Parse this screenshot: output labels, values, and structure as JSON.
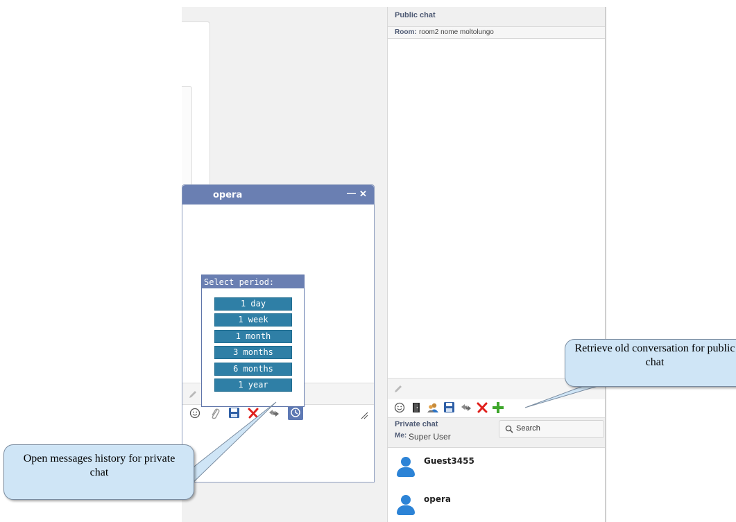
{
  "public_chat": {
    "title": "Public chat",
    "room_label": "Room:",
    "room_name": "room2 nome moltolungo",
    "toolbar_icons": [
      "smiley-icon",
      "door-icon",
      "users-icon",
      "save-icon",
      "refresh-icon",
      "delete-icon",
      "add-icon"
    ]
  },
  "private_chat": {
    "title": "Private chat",
    "me_label": "Me:",
    "me_name": "Super User",
    "search_placeholder": "Search",
    "users": [
      {
        "name": "Guest3455"
      },
      {
        "name": "opera"
      }
    ]
  },
  "chat_window": {
    "title": "opera",
    "minimize_glyph": "—",
    "close_glyph": "✕",
    "toolbar_icons": [
      "smiley-icon",
      "attach-icon",
      "save-icon",
      "delete-icon",
      "refresh-icon",
      "history-icon"
    ]
  },
  "period_popup": {
    "title": "Select period:",
    "options": [
      "1 day",
      "1 week",
      "1 month",
      "3 months",
      "6 months",
      "1 year"
    ]
  },
  "callouts": {
    "public": "Retrieve old conversation for public chat",
    "private": "Open messages history for private chat"
  },
  "colors": {
    "chat_title_bg": "#6a7fb2",
    "period_button": "#2f7fa6",
    "callout_bg": "#cfe5f6",
    "avatar": "#2c83d6"
  }
}
